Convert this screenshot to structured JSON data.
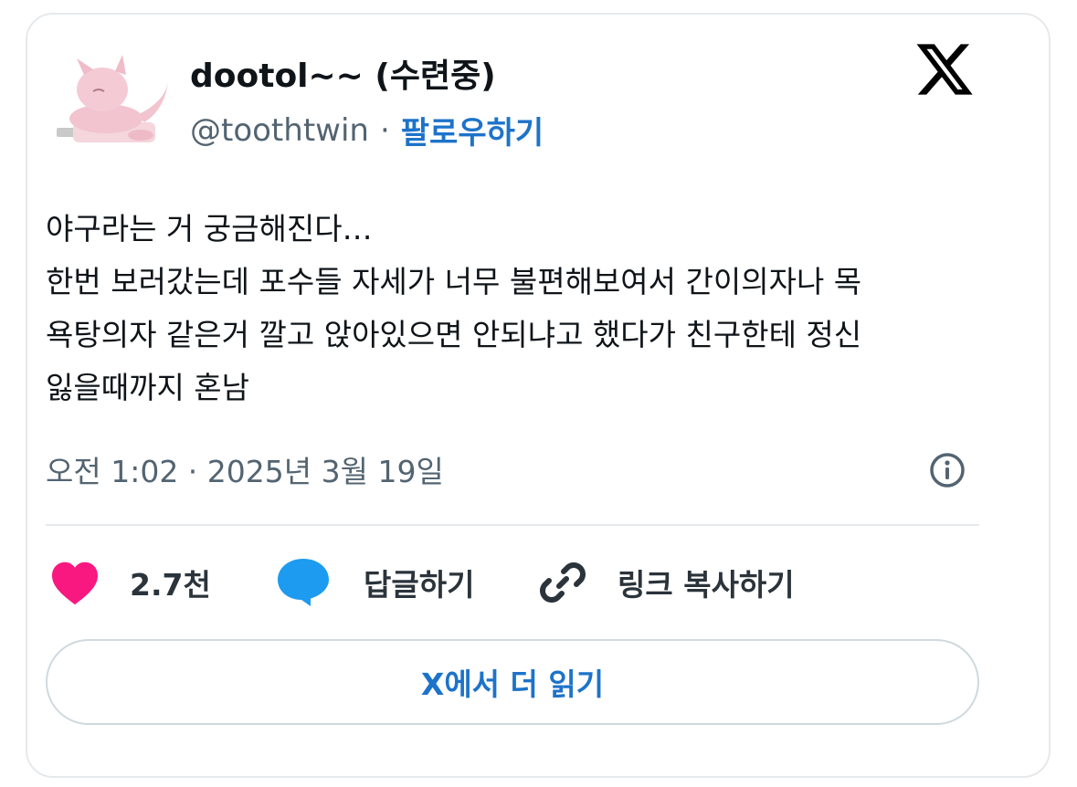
{
  "author": {
    "display_name": "dootol~~ (수련중)",
    "handle": "@toothtwin",
    "separator": "·",
    "follow_label": "팔로우하기"
  },
  "logo": "x-logo-icon",
  "tweet": {
    "lines": [
      "야구라는 거 궁금해진다…",
      "한번 보러갔는데 포수들 자세가 너무 불편해보여서 간이의자나 목",
      "욕탕의자 같은거 깔고 앉아있으면 안되냐고 했다가 친구한테 정신",
      "잃을때까지 혼남"
    ],
    "timestamp": "오전 1:02 · 2025년 3월 19일"
  },
  "actions": {
    "like_count": "2.7천",
    "reply_label": "답글하기",
    "copy_link_label": "링크 복사하기"
  },
  "read_more_label": "X에서 더 읽기",
  "colors": {
    "like": "#f91880",
    "reply": "#1d9bf0",
    "link_blue": "#1d73c9",
    "muted": "#536471",
    "border": "#e6e9ec"
  }
}
